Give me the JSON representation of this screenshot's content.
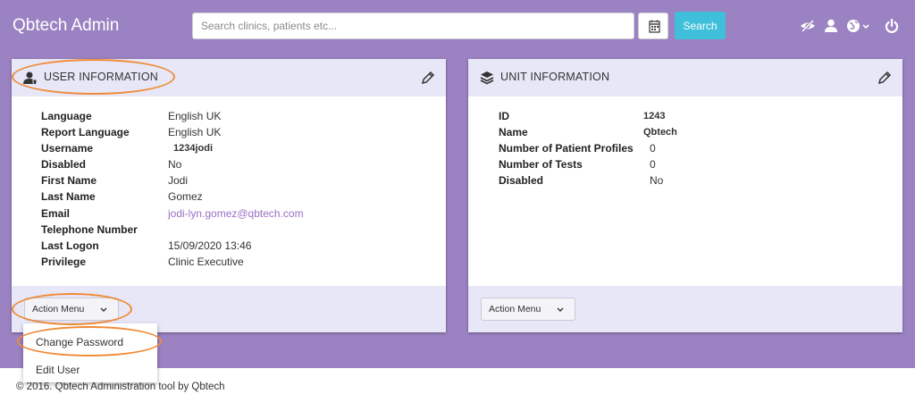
{
  "header": {
    "title": "Qbtech Admin",
    "search_placeholder": "Search clinics, patients etc...",
    "search_button": "Search"
  },
  "user_panel": {
    "title": "USER INFORMATION",
    "rows": [
      {
        "label": "Language",
        "value": "English UK"
      },
      {
        "label": "Report Language",
        "value": "English UK"
      },
      {
        "label": "Username",
        "value": "1234jodi"
      },
      {
        "label": "Disabled",
        "value": "No"
      },
      {
        "label": "First Name",
        "value": "Jodi"
      },
      {
        "label": "Last Name",
        "value": "Gomez"
      },
      {
        "label": "Email",
        "value": "jodi-lyn.gomez@qbtech.com"
      },
      {
        "label": "Telephone Number",
        "value": ""
      },
      {
        "label": "Last Logon",
        "value": "15/09/2020 13:46"
      },
      {
        "label": "Privilege",
        "value": "Clinic Executive"
      }
    ],
    "action_menu": "Action Menu"
  },
  "unit_panel": {
    "title": "UNIT INFORMATION",
    "rows": [
      {
        "label": "ID",
        "value": "1243"
      },
      {
        "label": "Name",
        "value": "Qbtech"
      },
      {
        "label": "Number of Patient Profiles",
        "value": "0"
      },
      {
        "label": "Number of Tests",
        "value": "0"
      },
      {
        "label": "Disabled",
        "value": "No"
      }
    ],
    "action_menu": "Action Menu"
  },
  "dropdown": {
    "items": [
      "Change Password",
      "Edit User"
    ]
  },
  "footer": {
    "text": "© 2016. Qbtech Administration tool by Qbtech"
  },
  "colors": {
    "background": "#9b82c2",
    "panel_header": "#e7e7f7",
    "search_button": "#3fbfd9",
    "link": "#9b6fc4",
    "annotation": "#f08a36"
  },
  "icons": {
    "calendar": "calendar-icon",
    "eye_slash": "eye-slash-icon",
    "user": "user-icon",
    "globe": "globe-icon",
    "power": "power-icon",
    "user_panel": "user-shield-icon",
    "unit_panel": "layers-icon",
    "edit": "pencil-icon"
  }
}
